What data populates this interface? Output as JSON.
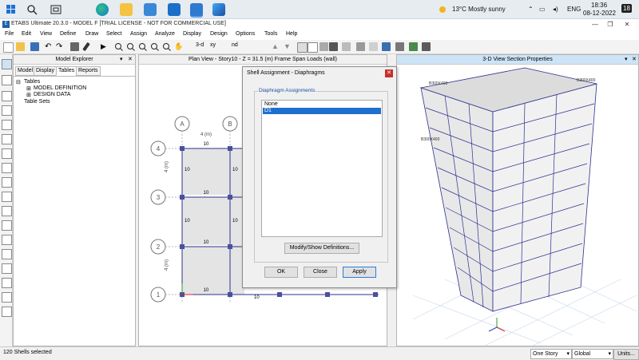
{
  "taskbar": {
    "weather": "13°C  Mostly sunny",
    "language": "ENG",
    "time": "18:36",
    "date": "08-12-2022",
    "notification_count": "18",
    "icons": [
      "windows-icon",
      "search-icon",
      "task-view-icon",
      "edge-icon",
      "file-explorer-icon",
      "store-icon",
      "mail-icon",
      "etabs-icon",
      "app-icon"
    ]
  },
  "window": {
    "title": "ETABS Ultimate 20.3.0 - MODEL F  [TRIAL LICENSE - NOT FOR COMMERCIAL USE]",
    "minimize": "—",
    "maximize": "❐",
    "close": "✕"
  },
  "menu": [
    "File",
    "Edit",
    "View",
    "Define",
    "Draw",
    "Select",
    "Assign",
    "Analyze",
    "Display",
    "Design",
    "Options",
    "Tools",
    "Help"
  ],
  "toolbar": {
    "label_3d": "3-d",
    "label_xy": "xy",
    "label_nd": "nd"
  },
  "explorer": {
    "title": "Model Explorer",
    "tabs": [
      "Model",
      "Display",
      "Tables",
      "Reports"
    ],
    "active_tab": "Tables",
    "tree": {
      "root": "Tables",
      "children": [
        "MODEL DEFINITION",
        "DESIGN DATA"
      ],
      "sibling": "Table Sets"
    }
  },
  "planview": {
    "title": "Plan View - Story10 - Z = 31.5 (m)  Frame Span Loads (wall)",
    "grid_cols": [
      "A",
      "B"
    ],
    "grid_rows": [
      "4",
      "3",
      "2",
      "1"
    ],
    "dim_top": "4 (m)",
    "dim_side": "4 (m)",
    "span_label": "10"
  },
  "view3d": {
    "title": "3-D View  Section Properties",
    "section_label": "B300X400"
  },
  "dialog": {
    "title": "Shell Assignment - Diaphragms",
    "group_label": "Diaphragm Assignments",
    "items": [
      "None",
      "D1"
    ],
    "selected": "D1",
    "modify_button": "Modify/Show Definitions...",
    "ok_button": "OK",
    "close_button": "Close",
    "apply_button": "Apply"
  },
  "status": {
    "message": "120 Shells selected",
    "story_mode": "One Story",
    "coord_system": "Global",
    "units_button": "Units..."
  },
  "colors": {
    "accent": "#1f6fd0",
    "frame": "#2b2f8f",
    "plan_fill": "#e4e4e4"
  }
}
